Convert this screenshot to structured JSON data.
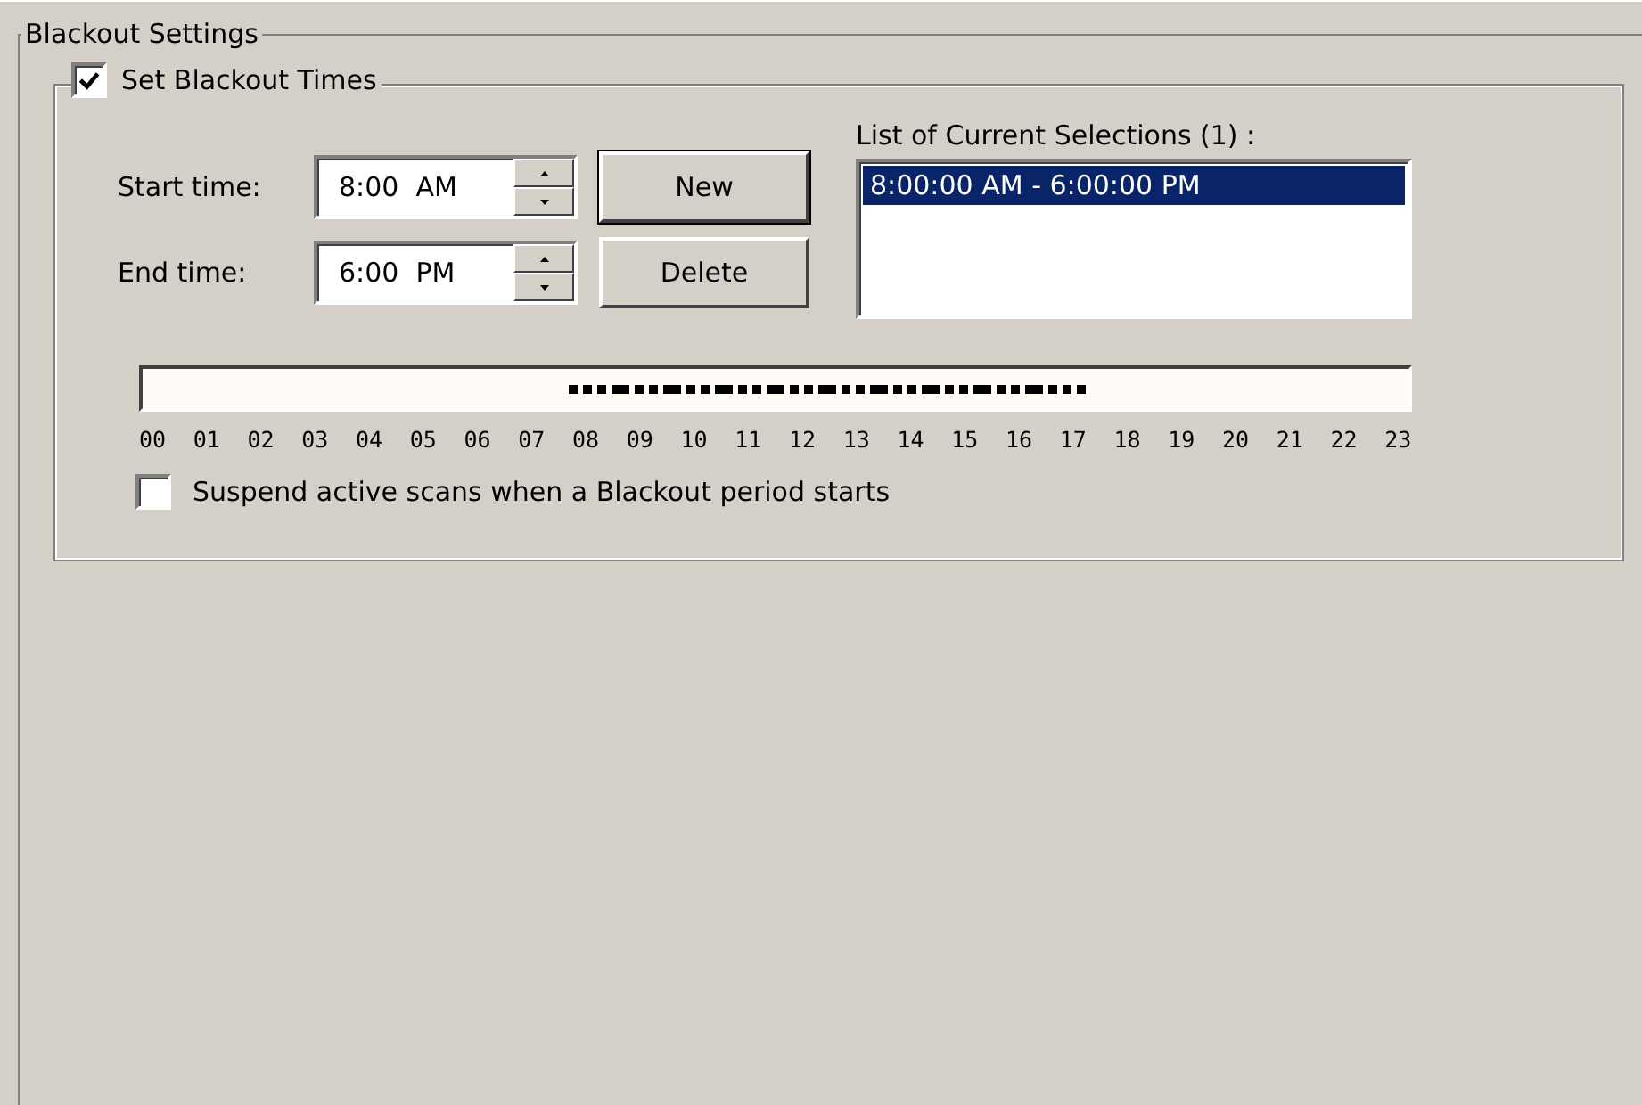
{
  "group": {
    "title": "Blackout Settings"
  },
  "blackout": {
    "label": "Set Blackout Times",
    "checked": true
  },
  "times": [
    {
      "label": "Start time:",
      "value": "8:00  AM"
    },
    {
      "label": "End time:",
      "value": "6:00  PM"
    }
  ],
  "buttons": [
    "New",
    "Delete"
  ],
  "selections": {
    "label": "List of Current Selections (1) :",
    "items": [
      {
        "text": "8:00:00 AM - 6:00:00 PM",
        "selected": true
      }
    ]
  },
  "timeline": [
    {
      "hour": "00",
      "blocked": false
    },
    {
      "hour": "01",
      "blocked": false
    },
    {
      "hour": "02",
      "blocked": false
    },
    {
      "hour": "03",
      "blocked": false
    },
    {
      "hour": "04",
      "blocked": false
    },
    {
      "hour": "05",
      "blocked": false
    },
    {
      "hour": "06",
      "blocked": false
    },
    {
      "hour": "07",
      "blocked": false
    },
    {
      "hour": "08",
      "blocked": true
    },
    {
      "hour": "09",
      "blocked": true
    },
    {
      "hour": "10",
      "blocked": true
    },
    {
      "hour": "11",
      "blocked": true
    },
    {
      "hour": "12",
      "blocked": true
    },
    {
      "hour": "13",
      "blocked": true
    },
    {
      "hour": "14",
      "blocked": true
    },
    {
      "hour": "15",
      "blocked": true
    },
    {
      "hour": "16",
      "blocked": true
    },
    {
      "hour": "17",
      "blocked": true
    },
    {
      "hour": "18",
      "blocked": false
    },
    {
      "hour": "19",
      "blocked": false
    },
    {
      "hour": "20",
      "blocked": false
    },
    {
      "hour": "21",
      "blocked": false
    },
    {
      "hour": "22",
      "blocked": false
    },
    {
      "hour": "23",
      "blocked": false
    }
  ],
  "suspend": {
    "label": "Suspend active scans when a Blackout period starts",
    "checked": false
  }
}
